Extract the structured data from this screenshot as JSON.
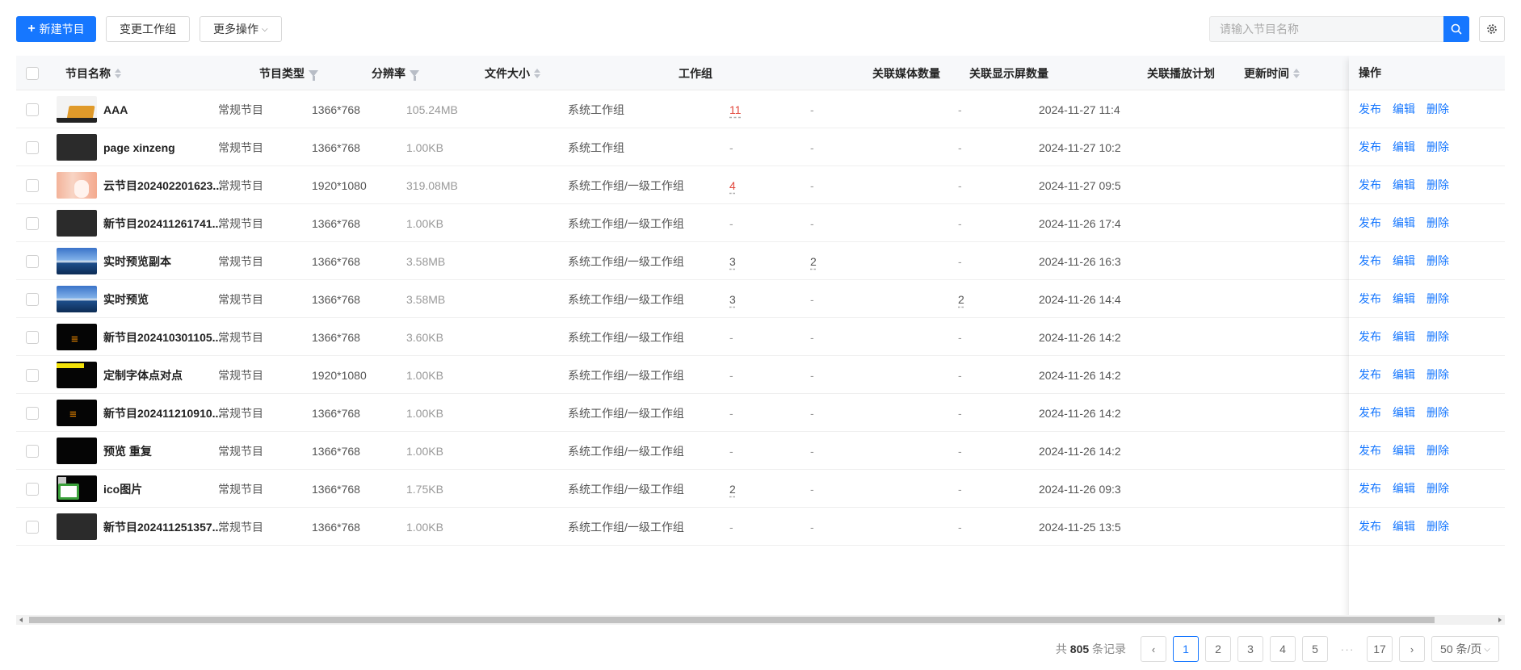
{
  "toolbar": {
    "new_label": "新建节目",
    "change_group_label": "变更工作组",
    "more_label": "更多操作",
    "search_placeholder": "请输入节目名称"
  },
  "columns": {
    "name": "节目名称",
    "type": "节目类型",
    "resolution": "分辨率",
    "size": "文件大小",
    "group": "工作组",
    "media_count": "关联媒体数量",
    "screen_count": "关联显示屏数量",
    "plan_count": "关联播放计划",
    "updated": "更新时间",
    "actions": "操作"
  },
  "action_labels": {
    "publish": "发布",
    "edit": "编辑",
    "delete": "删除"
  },
  "rows": [
    {
      "thumb": "aaa",
      "name": "AAA",
      "type": "常规节目",
      "resolution": "1366*768",
      "size": "105.24MB",
      "group": "系统工作组",
      "media": "11",
      "media_red": true,
      "screens": "-",
      "plans": "-",
      "updated": "2024-11-27 11:4"
    },
    {
      "thumb": "dark",
      "name": "page xinzeng",
      "type": "常规节目",
      "resolution": "1366*768",
      "size": "1.00KB",
      "group": "系统工作组",
      "media": "-",
      "screens": "-",
      "plans": "-",
      "updated": "2024-11-27 10:2"
    },
    {
      "thumb": "pink",
      "name": "云节目202402201623...",
      "type": "常规节目",
      "resolution": "1920*1080",
      "size": "319.08MB",
      "group": "系统工作组/一级工作组",
      "media": "4",
      "media_red": true,
      "screens": "-",
      "plans": "-",
      "updated": "2024-11-27 09:5"
    },
    {
      "thumb": "dark",
      "name": "新节目202411261741...",
      "type": "常规节目",
      "resolution": "1366*768",
      "size": "1.00KB",
      "group": "系统工作组/一级工作组",
      "media": "-",
      "screens": "-",
      "plans": "-",
      "updated": "2024-11-26 17:4"
    },
    {
      "thumb": "sky",
      "name": "实时预览副本",
      "type": "常规节目",
      "resolution": "1366*768",
      "size": "3.58MB",
      "group": "系统工作组/一级工作组",
      "media": "3",
      "screens": "2",
      "plans": "-",
      "updated": "2024-11-26 16:3"
    },
    {
      "thumb": "sky",
      "name": "实时预览",
      "type": "常规节目",
      "resolution": "1366*768",
      "size": "3.58MB",
      "group": "系统工作组/一级工作组",
      "media": "3",
      "screens": "-",
      "plans": "2",
      "updated": "2024-11-26 14:4"
    },
    {
      "thumb": "rss",
      "name": "新节目202410301105...",
      "type": "常规节目",
      "resolution": "1366*768",
      "size": "3.60KB",
      "group": "系统工作组/一级工作组",
      "media": "-",
      "screens": "-",
      "plans": "-",
      "updated": "2024-11-26 14:2"
    },
    {
      "thumb": "yellowbar",
      "name": "定制字体点对点",
      "type": "常规节目",
      "resolution": "1920*1080",
      "size": "1.00KB",
      "group": "系统工作组/一级工作组",
      "media": "-",
      "screens": "-",
      "plans": "-",
      "updated": "2024-11-26 14:2"
    },
    {
      "thumb": "rss2",
      "name": "新节目202411210910...",
      "type": "常规节目",
      "resolution": "1366*768",
      "size": "1.00KB",
      "group": "系统工作组/一级工作组",
      "media": "-",
      "screens": "-",
      "plans": "-",
      "updated": "2024-11-26 14:2"
    },
    {
      "thumb": "black",
      "name": "预览 重复",
      "type": "常规节目",
      "resolution": "1366*768",
      "size": "1.00KB",
      "group": "系统工作组/一级工作组",
      "media": "-",
      "screens": "-",
      "plans": "-",
      "updated": "2024-11-26 14:2"
    },
    {
      "thumb": "ico",
      "name": "ico图片",
      "type": "常规节目",
      "resolution": "1366*768",
      "size": "1.75KB",
      "group": "系统工作组/一级工作组",
      "media": "2",
      "screens": "-",
      "plans": "-",
      "updated": "2024-11-26 09:3"
    },
    {
      "thumb": "dark",
      "name": "新节目202411251357...",
      "type": "常规节目",
      "resolution": "1366*768",
      "size": "1.00KB",
      "group": "系统工作组/一级工作组",
      "media": "-",
      "screens": "-",
      "plans": "-",
      "updated": "2024-11-25 13:5"
    }
  ],
  "pagination": {
    "total_prefix": "共",
    "total_count": "805",
    "total_suffix": "条记录",
    "pages": [
      "1",
      "2",
      "3",
      "4",
      "5"
    ],
    "ellipsis": "···",
    "last_page": "17",
    "current_page": "1",
    "page_size": "50 条/页"
  },
  "colors": {
    "primary": "#1677ff",
    "danger": "#e2473c"
  }
}
